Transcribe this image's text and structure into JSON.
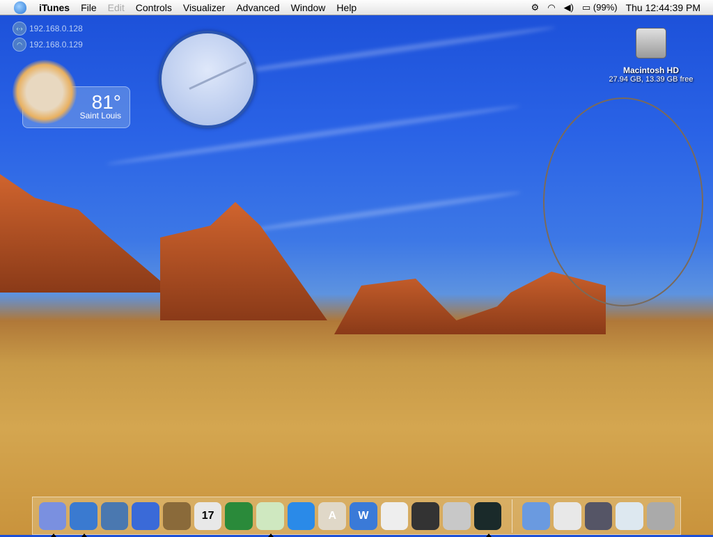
{
  "menubar": {
    "app": "iTunes",
    "items": [
      "File",
      "Edit",
      "Controls",
      "Visualizer",
      "Advanced",
      "Window",
      "Help"
    ],
    "disabled": [
      "Edit"
    ],
    "battery": "(99%)",
    "clock": "Thu 12:44:39 PM",
    "status_icons": [
      "gear-icon",
      "wifi-icon",
      "volume-icon",
      "battery-plug-icon"
    ]
  },
  "widgets": {
    "ip_ethernet": "192.168.0.128",
    "ip_wifi": "192.168.0.129",
    "weather": {
      "temp": "81°",
      "city": "Saint Louis"
    }
  },
  "desktop": {
    "hd_name": "Macintosh HD",
    "hd_info": "27.94 GB, 13.39 GB free"
  },
  "dock": {
    "apps": [
      {
        "name": "finder",
        "color": "#7a90e0",
        "running": true
      },
      {
        "name": "safari",
        "color": "#3a7ad0",
        "running": true
      },
      {
        "name": "preview",
        "color": "#4a78b0",
        "running": false
      },
      {
        "name": "ichat",
        "color": "#3a6ad8",
        "running": false
      },
      {
        "name": "address-book",
        "color": "#8a6a3a",
        "running": false
      },
      {
        "name": "ical",
        "color": "#e8e8e8",
        "label": "17",
        "running": false
      },
      {
        "name": "globe",
        "color": "#2a8a3a",
        "running": false
      },
      {
        "name": "itunes",
        "color": "#cfe8c0",
        "running": true
      },
      {
        "name": "quicktime",
        "color": "#2a8ae8",
        "running": false
      },
      {
        "name": "font-book",
        "color": "#e0d8c8",
        "label": "A",
        "running": false
      },
      {
        "name": "word",
        "color": "#3a7ad8",
        "label": "W",
        "running": false
      },
      {
        "name": "textedit",
        "color": "#eeeeee",
        "running": false
      },
      {
        "name": "sherlock",
        "color": "#333333",
        "running": false
      },
      {
        "name": "system-preferences",
        "color": "#c8c8c8",
        "running": false
      },
      {
        "name": "activity-monitor",
        "color": "#1a2a2a",
        "running": true
      }
    ],
    "others": [
      {
        "name": "applications-folder",
        "color": "#6a9ae0"
      },
      {
        "name": "minimized-window-1",
        "color": "#e8e8e8"
      },
      {
        "name": "minimized-window-2",
        "color": "#556"
      },
      {
        "name": "minimized-window-3",
        "color": "#dde8f0"
      },
      {
        "name": "trash",
        "color": "#aaaaaa"
      }
    ]
  }
}
